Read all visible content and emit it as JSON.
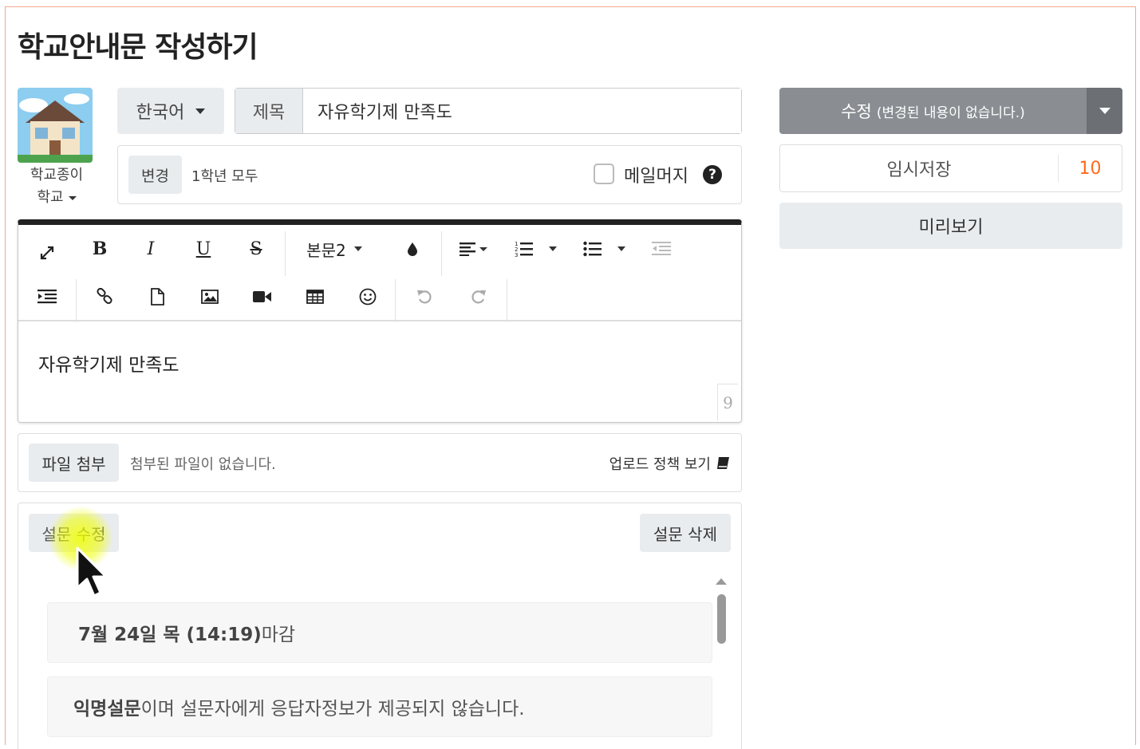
{
  "page": {
    "title": "학교안내문 작성하기"
  },
  "school": {
    "name_line1": "학교종이",
    "name_line2": "학교"
  },
  "language": {
    "selected": "한국어"
  },
  "title_field": {
    "label": "제목",
    "value": "자유학기제 만족도"
  },
  "target": {
    "change_label": "변경",
    "value": "1학년 모두"
  },
  "mail_merge": {
    "label": "메일머지",
    "checked": false,
    "help": "?"
  },
  "toolbar": {
    "bold": "B",
    "italic": "I",
    "underline": "U",
    "strike": "S",
    "paragraph_style": "본문2"
  },
  "editor": {
    "content": "자유학기제 만족도",
    "char_count": "9"
  },
  "attachment": {
    "button": "파일 첨부",
    "status": "첨부된 파일이 없습니다.",
    "policy_link": "업로드 정책 보기"
  },
  "survey": {
    "edit_label": "설문 수정",
    "delete_label": "설문 삭제",
    "deadline_bold": "7월 24일 목 (14:19)",
    "deadline_suffix": "마감",
    "anonymous_bold": "익명설문",
    "anonymous_rest": "이며 설문자에게 응답자정보가 제공되지 않습니다."
  },
  "actions": {
    "save_label": "수정",
    "save_note": "(변경된 내용이 없습니다.)",
    "draft_label": "임시저장",
    "draft_count": "10",
    "preview_label": "미리보기"
  },
  "colors": {
    "accent_orange": "#ff6a1a",
    "save_gray": "#8a8e92",
    "button_gray": "#e9ecef"
  }
}
